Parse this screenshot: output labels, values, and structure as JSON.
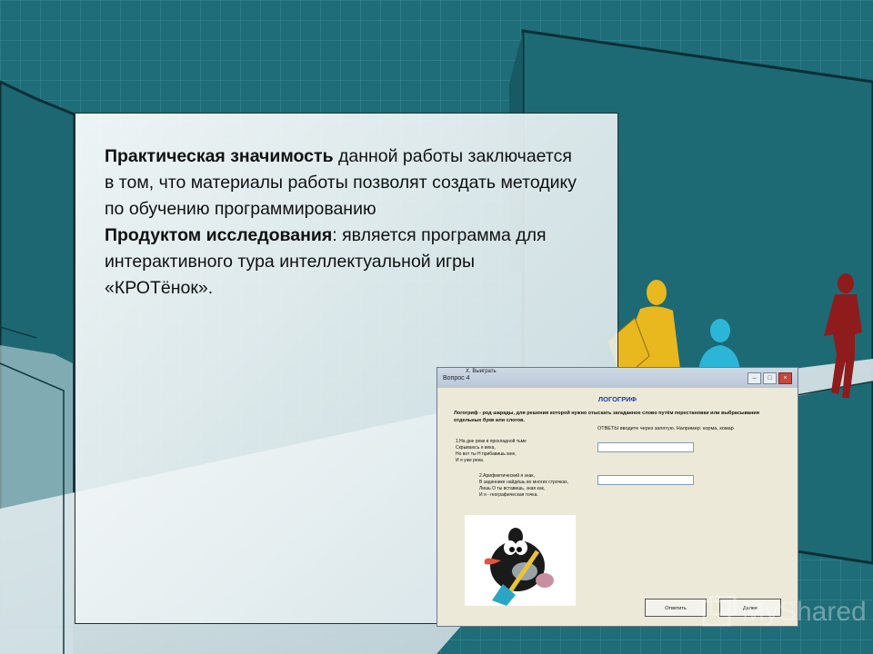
{
  "slide": {
    "paragraph1_bold": "Практическая значимость",
    "paragraph1_rest": " данной работы заключается в том, что материалы работы позволят создать методику по обучению программированию",
    "paragraph2_bold": "Продуктом исследования",
    "paragraph2_rest": ": является программа для интерактивного тура интеллектуальной игры «КРОТёнок»."
  },
  "screenshot": {
    "behind_title": "Х. Выиграть",
    "window_title": "Вопрос 4",
    "heading": "ЛОГОГРИФ",
    "description": "Логогриф - род шарады, для решения которой нужно отыскать загаданное слово путём перестановки или выбрасывания отдельных букв или слогов.",
    "hint": "ОТВЕТЫ вводите через запятую. Например: корма, комар",
    "riddle1": "1.На дне реки в прохладной тьме\nСкрываюсь я века,\nНо вот ты Н прибавишь мне,\nИ я уже река.",
    "riddle2": "2.Арифметический я знак,\nВ задачнике найдёшь во многих строчках,\nЛишь О ты вставишь, зная как,\nИ я - географическая точка.",
    "answer_button": "Ответить",
    "next_button": "Далее",
    "minimize": "–",
    "maximize": "□",
    "close": "×"
  },
  "watermark": {
    "text": "MyShared"
  },
  "colors": {
    "background": "#1e6d78",
    "figure_yellow": "#e8b81e",
    "figure_cyan": "#2bb6d8",
    "figure_red": "#8e1c1c"
  }
}
